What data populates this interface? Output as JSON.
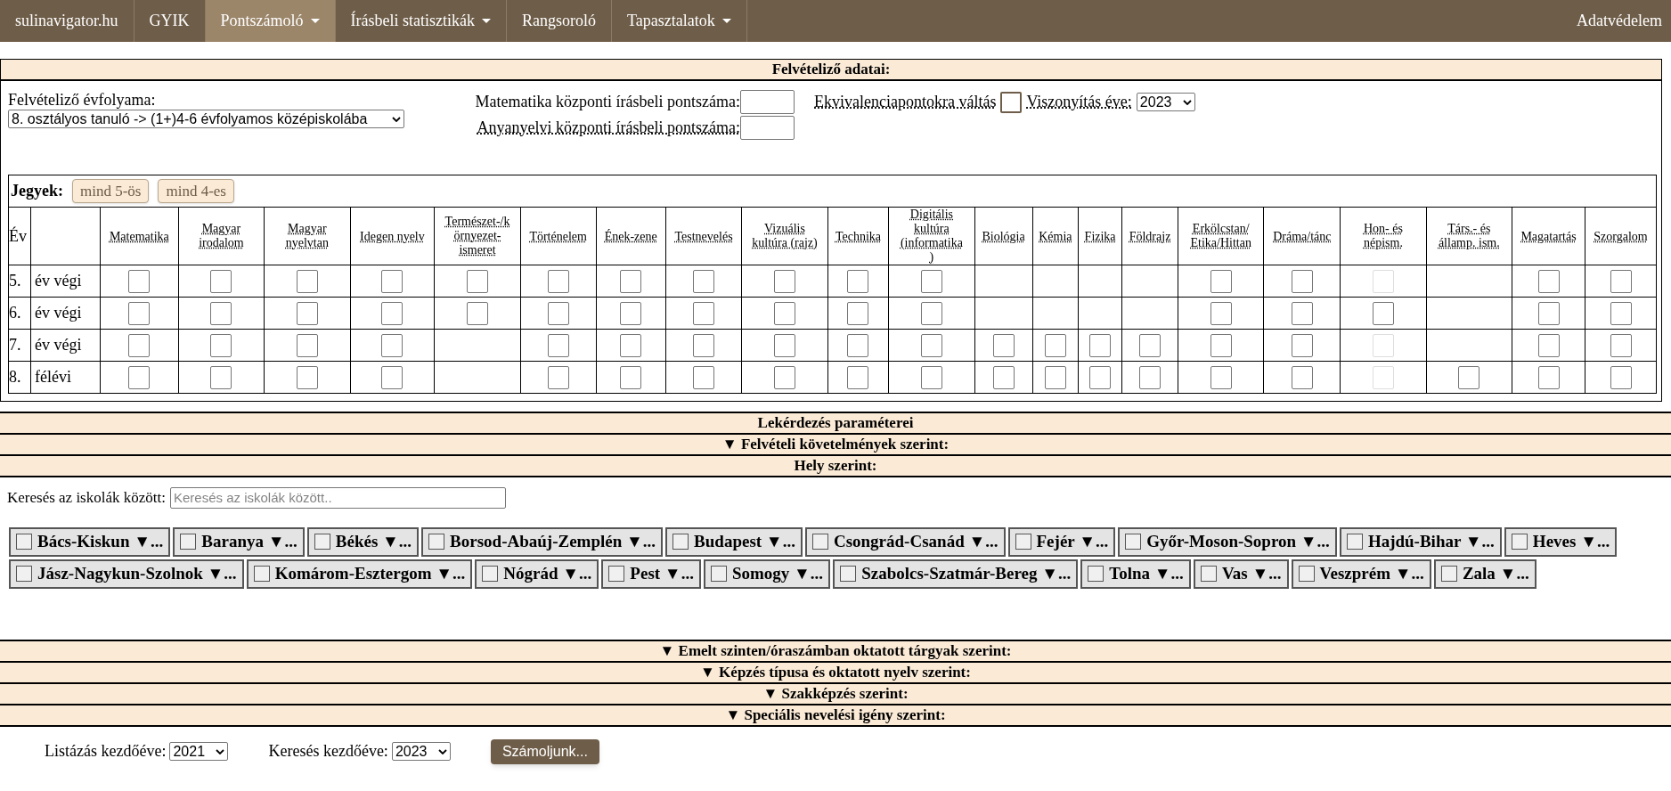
{
  "nav": {
    "items": [
      {
        "label": "sulinavigator.hu",
        "selected": false,
        "has_menu": false
      },
      {
        "label": "GYIK",
        "selected": false,
        "has_menu": false
      },
      {
        "label": "Pontszámoló",
        "selected": true,
        "has_menu": true
      },
      {
        "label": "Írásbeli statisztikák",
        "selected": false,
        "has_menu": true
      },
      {
        "label": "Rangsoroló",
        "selected": false,
        "has_menu": false
      },
      {
        "label": "Tapasztalatok",
        "selected": false,
        "has_menu": true
      }
    ],
    "right_item": "Adatvédelem"
  },
  "applicant": {
    "title": "Felvételiző adatai:",
    "grade_label": "Felvételiző évfolyama:",
    "grade_value": "8. osztályos tanuló -> (1+)4-6 évfolyamos középiskolába",
    "math_label": "Matematika központi írásbeli pontszáma:",
    "lang_label": "Anyanyelvi központi írásbeli pontszáma:",
    "equivalence_label": "Ekvivalenciapontokra váltás",
    "equivalence_checked": false,
    "reference_year_label": "Viszonyítás éve:",
    "reference_year": "2023"
  },
  "grades": {
    "label": "Jegyek:",
    "buttons": [
      "mind 5-ös",
      "mind 4-es"
    ],
    "year_header": "Év",
    "subjects": [
      "Matematika",
      "Magyar irodalom",
      "Magyar nyelvtan",
      "Idegen nyelv",
      "Természet-/környezet-ismeret",
      "Történelem",
      "Ének-zene",
      "Testnevelés",
      "Vizuális kultúra (rajz)",
      "Technika",
      "Digitális kultúra (informatika)",
      "Biológia",
      "Kémia",
      "Fizika",
      "Földrajz",
      "Erkölcstan/ Etika/Hittan",
      "Dráma/tánc",
      "Hon- és népism.",
      "Társ.- és államp. ism.",
      "Magatartás",
      "Szorgalom"
    ],
    "rows": [
      {
        "year": "5.",
        "term": "év végi",
        "cells": [
          {
            "kind": "input"
          },
          {
            "kind": "input"
          },
          {
            "kind": "input"
          },
          {
            "kind": "input"
          },
          {
            "kind": "input"
          },
          {
            "kind": "input"
          },
          {
            "kind": "input"
          },
          {
            "kind": "input"
          },
          {
            "kind": "input"
          },
          {
            "kind": "input"
          },
          {
            "kind": "input"
          },
          {
            "kind": "none"
          },
          {
            "kind": "none"
          },
          {
            "kind": "none"
          },
          {
            "kind": "none"
          },
          {
            "kind": "input"
          },
          {
            "kind": "input"
          },
          {
            "kind": "disabled"
          },
          {
            "kind": "none"
          },
          {
            "kind": "input"
          },
          {
            "kind": "input"
          }
        ]
      },
      {
        "year": "6.",
        "term": "év végi",
        "cells": [
          {
            "kind": "input"
          },
          {
            "kind": "input"
          },
          {
            "kind": "input"
          },
          {
            "kind": "input"
          },
          {
            "kind": "input"
          },
          {
            "kind": "input"
          },
          {
            "kind": "input"
          },
          {
            "kind": "input"
          },
          {
            "kind": "input"
          },
          {
            "kind": "input"
          },
          {
            "kind": "input"
          },
          {
            "kind": "none"
          },
          {
            "kind": "none"
          },
          {
            "kind": "none"
          },
          {
            "kind": "none"
          },
          {
            "kind": "input"
          },
          {
            "kind": "input"
          },
          {
            "kind": "input"
          },
          {
            "kind": "none"
          },
          {
            "kind": "input"
          },
          {
            "kind": "input"
          }
        ]
      },
      {
        "year": "7.",
        "term": "év végi",
        "cells": [
          {
            "kind": "input"
          },
          {
            "kind": "input"
          },
          {
            "kind": "input"
          },
          {
            "kind": "input"
          },
          {
            "kind": "none"
          },
          {
            "kind": "input"
          },
          {
            "kind": "input"
          },
          {
            "kind": "input"
          },
          {
            "kind": "input"
          },
          {
            "kind": "input"
          },
          {
            "kind": "input"
          },
          {
            "kind": "input"
          },
          {
            "kind": "input"
          },
          {
            "kind": "input"
          },
          {
            "kind": "input"
          },
          {
            "kind": "input"
          },
          {
            "kind": "input"
          },
          {
            "kind": "disabled"
          },
          {
            "kind": "none"
          },
          {
            "kind": "input"
          },
          {
            "kind": "input"
          }
        ]
      },
      {
        "year": "8.",
        "term": "félévi",
        "cells": [
          {
            "kind": "input"
          },
          {
            "kind": "input"
          },
          {
            "kind": "input"
          },
          {
            "kind": "input"
          },
          {
            "kind": "none"
          },
          {
            "kind": "input"
          },
          {
            "kind": "input"
          },
          {
            "kind": "input"
          },
          {
            "kind": "input"
          },
          {
            "kind": "input"
          },
          {
            "kind": "input"
          },
          {
            "kind": "input"
          },
          {
            "kind": "input"
          },
          {
            "kind": "input"
          },
          {
            "kind": "input"
          },
          {
            "kind": "input"
          },
          {
            "kind": "input"
          },
          {
            "kind": "disabled"
          },
          {
            "kind": "input"
          },
          {
            "kind": "input"
          },
          {
            "kind": "input"
          }
        ]
      }
    ]
  },
  "query": {
    "title": "Lekérdezés paraméterei",
    "requirements_header": "▼ Felvételi követelmények szerint:",
    "location_header": "Hely szerint:",
    "search_label": "Keresés az iskolák között:",
    "search_placeholder": "Keresés az iskolák között..",
    "counties": [
      {
        "label": "Bács-Kiskun",
        "more": "▼...",
        "checked": false
      },
      {
        "label": "Baranya",
        "more": "▼...",
        "checked": false
      },
      {
        "label": "Békés",
        "more": "▼...",
        "checked": false
      },
      {
        "label": "Borsod-Abaúj-Zemplén",
        "more": "▼...",
        "checked": false
      },
      {
        "label": "Budapest",
        "more": "▼...",
        "checked": false
      },
      {
        "label": "Csongrád-Csanád",
        "more": "▼...",
        "checked": false
      },
      {
        "label": "Fejér",
        "more": "▼...",
        "checked": false
      },
      {
        "label": "Győr-Moson-Sopron",
        "more": "▼...",
        "checked": false
      },
      {
        "label": "Hajdú-Bihar",
        "more": "▼...",
        "checked": false
      },
      {
        "label": "Heves",
        "more": "▼...",
        "checked": false
      },
      {
        "label": "Jász-Nagykun-Szolnok",
        "more": "▼...",
        "checked": false
      },
      {
        "label": "Komárom-Esztergom",
        "more": "▼...",
        "checked": false
      },
      {
        "label": "Nógrád",
        "more": "▼...",
        "checked": false
      },
      {
        "label": "Pest",
        "more": "▼...",
        "checked": false
      },
      {
        "label": "Somogy",
        "more": "▼...",
        "checked": false
      },
      {
        "label": "Szabolcs-Szatmár-Bereg",
        "more": "▼...",
        "checked": false
      },
      {
        "label": "Tolna",
        "more": "▼...",
        "checked": false
      },
      {
        "label": "Vas",
        "more": "▼...",
        "checked": false
      },
      {
        "label": "Veszprém",
        "more": "▼...",
        "checked": false
      },
      {
        "label": "Zala",
        "more": "▼...",
        "checked": false
      }
    ],
    "more_headers": [
      "▼ Emelt szinten/óraszámban oktatott tárgyak szerint:",
      "▼ Képzés típusa és oktatott nyelv szerint:",
      "▼ Szakképzés szerint:",
      "▼ Speciális nevelési igény szerint:"
    ]
  },
  "footer": {
    "list_start_label": "Listázás kezdőéve:",
    "list_start": "2021",
    "search_start_label": "Keresés kezdőéve:",
    "search_start": "2023",
    "submit": "Számoljunk..."
  }
}
